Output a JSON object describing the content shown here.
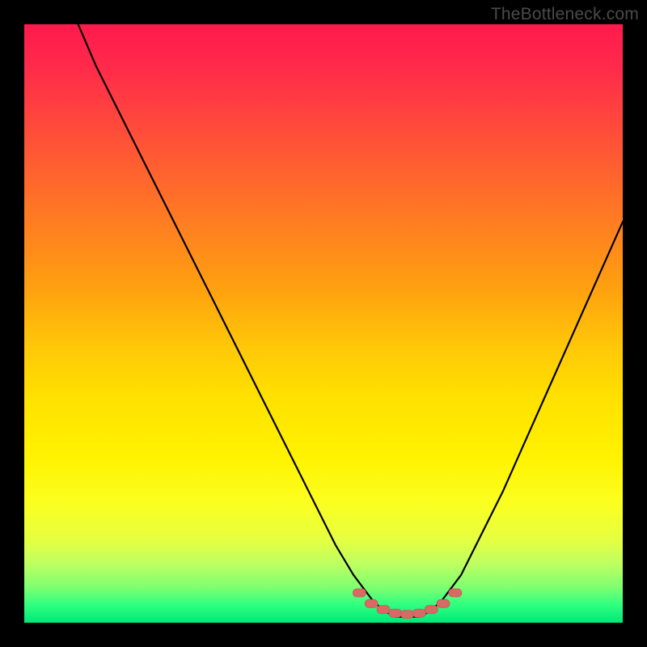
{
  "watermark": "TheBottleneck.com",
  "colors": {
    "curve_stroke": "#000000",
    "marker_fill": "#d86a66",
    "marker_stroke": "#c45a56",
    "background_black": "#000000"
  },
  "chart_data": {
    "type": "line",
    "title": "",
    "xlabel": "",
    "ylabel": "",
    "xlim": [
      0,
      100
    ],
    "ylim": [
      0,
      100
    ],
    "grid": false,
    "series": [
      {
        "name": "bottleneck-curve",
        "x": [
          9,
          12,
          16,
          20,
          24,
          28,
          32,
          36,
          40,
          44,
          48,
          52,
          55,
          58,
          60,
          62,
          64,
          66,
          68,
          70,
          73,
          76,
          80,
          84,
          88,
          92,
          96,
          100
        ],
        "values": [
          100,
          93,
          85,
          77,
          69,
          61,
          53,
          45,
          37,
          29,
          21,
          13,
          8,
          4,
          2,
          1,
          1,
          1,
          2,
          4,
          8,
          14,
          22,
          31,
          40,
          49,
          58,
          67
        ]
      }
    ],
    "markers": {
      "name": "highlight-segment",
      "x": [
        56,
        58,
        60,
        62,
        64,
        66,
        68,
        70,
        72
      ],
      "values": [
        5,
        3.2,
        2.2,
        1.6,
        1.4,
        1.6,
        2.2,
        3.2,
        5
      ]
    }
  }
}
